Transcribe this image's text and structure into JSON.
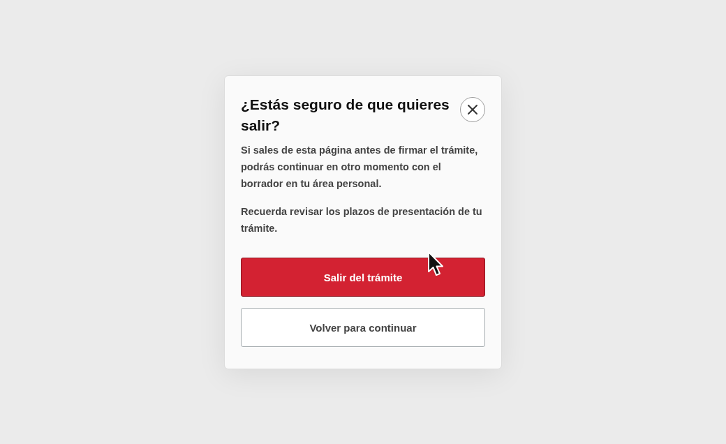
{
  "dialog": {
    "title": "¿Estás seguro de que quieres salir?",
    "paragraphs": [
      "Si sales de esta página antes de firmar el trámite, podrás continuar en otro momento con el borrador en tu área personal.",
      "Recuerda revisar los plazos de presentación de tu trámite."
    ],
    "buttons": [
      {
        "label": "Salir del trámite",
        "kind": "primary"
      },
      {
        "label": "Volver para continuar",
        "kind": "secondary"
      }
    ]
  }
}
